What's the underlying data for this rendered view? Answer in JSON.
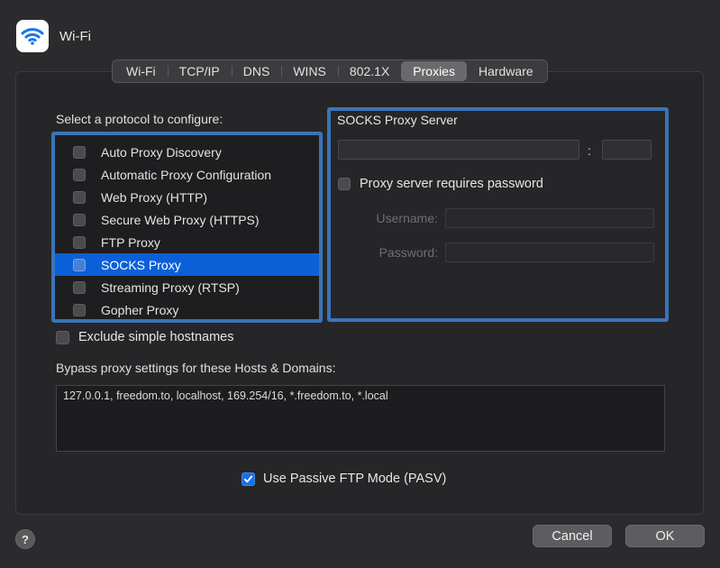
{
  "window": {
    "title": "Wi-Fi",
    "icon": "wifi-icon",
    "accent": "#3a75b8",
    "selection": "#0b60d8"
  },
  "tabs": [
    {
      "label": "Wi-Fi",
      "active": false
    },
    {
      "label": "TCP/IP",
      "active": false
    },
    {
      "label": "DNS",
      "active": false
    },
    {
      "label": "WINS",
      "active": false
    },
    {
      "label": "802.1X",
      "active": false
    },
    {
      "label": "Proxies",
      "active": true
    },
    {
      "label": "Hardware",
      "active": false
    }
  ],
  "protocols": {
    "heading": "Select a protocol to configure:",
    "items": [
      {
        "label": "Auto Proxy Discovery",
        "checked": false,
        "selected": false
      },
      {
        "label": "Automatic Proxy Configuration",
        "checked": false,
        "selected": false
      },
      {
        "label": "Web Proxy (HTTP)",
        "checked": false,
        "selected": false
      },
      {
        "label": "Secure Web Proxy (HTTPS)",
        "checked": false,
        "selected": false
      },
      {
        "label": "FTP Proxy",
        "checked": false,
        "selected": false
      },
      {
        "label": "SOCKS Proxy",
        "checked": false,
        "selected": true
      },
      {
        "label": "Streaming Proxy (RTSP)",
        "checked": false,
        "selected": false
      },
      {
        "label": "Gopher Proxy",
        "checked": false,
        "selected": false
      }
    ]
  },
  "socks": {
    "title": "SOCKS Proxy Server",
    "server_value": "",
    "port_separator": ":",
    "port_value": "",
    "requires_password_label": "Proxy server requires password",
    "requires_password": false,
    "username_label": "Username:",
    "username_value": "",
    "password_label": "Password:",
    "password_value": ""
  },
  "exclude": {
    "label": "Exclude simple hostnames",
    "checked": false
  },
  "bypass": {
    "label": "Bypass proxy settings for these Hosts & Domains:",
    "value": "127.0.0.1, freedom.to, localhost, 169.254/16, *.freedom.to, *.local"
  },
  "pasv": {
    "label": "Use Passive FTP Mode (PASV)",
    "checked": true
  },
  "footer": {
    "help_label": "?",
    "cancel_label": "Cancel",
    "ok_label": "OK"
  }
}
